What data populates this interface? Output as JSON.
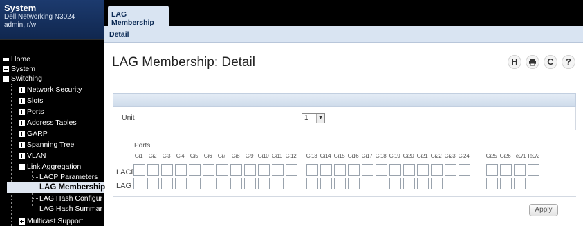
{
  "system": {
    "title": "System",
    "model": "Dell Networking N3024",
    "user": "admin, r/w"
  },
  "nav": [
    {
      "label": "Home",
      "icon": "home-icon"
    },
    {
      "label": "System",
      "icon": "expand-plus-icon"
    },
    {
      "label": "Switching",
      "icon": "collapse-minus-icon"
    },
    {
      "label": "Network Security",
      "icon": "expand-plus-icon"
    },
    {
      "label": "Slots",
      "icon": "expand-plus-icon"
    },
    {
      "label": "Ports",
      "icon": "expand-plus-icon"
    },
    {
      "label": "Address Tables",
      "icon": "expand-plus-icon"
    },
    {
      "label": "GARP",
      "icon": "expand-plus-icon"
    },
    {
      "label": "Spanning Tree",
      "icon": "expand-plus-icon"
    },
    {
      "label": "VLAN",
      "icon": "expand-plus-icon"
    },
    {
      "label": "Link Aggregation",
      "icon": "collapse-minus-icon"
    },
    {
      "label": "LACP Parameters",
      "icon": "tree-leaf"
    },
    {
      "label": "LAG Membership",
      "icon": "tree-leaf",
      "selected": true
    },
    {
      "label": "LAG Hash Configur",
      "icon": "tree-leaf"
    },
    {
      "label": "LAG Hash Summar",
      "icon": "tree-leaf"
    },
    {
      "label": "Multicast Support",
      "icon": "expand-plus-icon"
    }
  ],
  "tabs": {
    "main": "LAG Membership",
    "sub": "Detail"
  },
  "page_title": "LAG Membership: Detail",
  "toolbar": {
    "save": "H",
    "print": "print-icon",
    "refresh": "C",
    "help": "?"
  },
  "unit": {
    "label": "Unit",
    "value": "1"
  },
  "ports": {
    "label": "Ports",
    "names": [
      "Gi1",
      "Gi2",
      "Gi3",
      "Gi4",
      "Gi5",
      "Gi6",
      "Gi7",
      "Gi8",
      "Gi9",
      "Gi10",
      "Gi11",
      "Gi12",
      "Gi13",
      "Gi14",
      "Gi15",
      "Gi16",
      "Gi17",
      "Gi18",
      "Gi19",
      "Gi20",
      "Gi21",
      "Gi22",
      "Gi23",
      "Gi24",
      "Gi25",
      "Gi26",
      "Te0/1",
      "Te0/2"
    ],
    "row_labels": [
      "LACP",
      "LAG"
    ]
  },
  "apply_label": "Apply"
}
